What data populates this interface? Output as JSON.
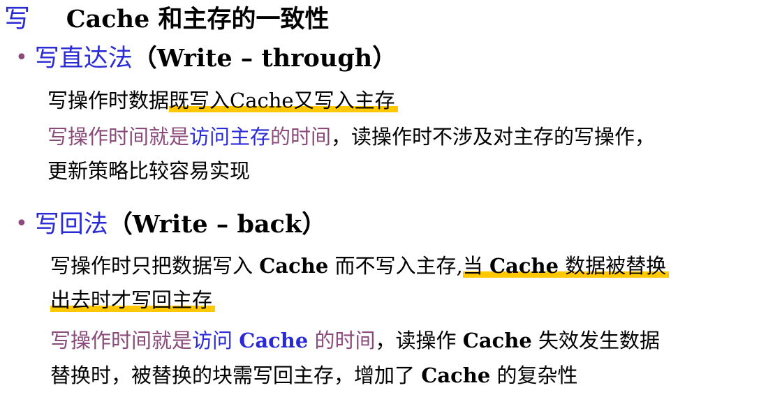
{
  "title": {
    "prefix": "写",
    "text": "Cache 和主存的一致性"
  },
  "write_through": {
    "bullet": "•",
    "heading_cn": "写直达法",
    "heading_en": "（Write – through）",
    "line1_a": "写操作时数据",
    "line1_highlight": "既写入Cache又写入主存",
    "line2_a": "写操作时间就是",
    "line2_b": "访问主存",
    "line2_c": "的时间",
    "line2_d": "，读操作时不涉及对主存的写操作，",
    "line3": "更新策略比较容易实现"
  },
  "write_back": {
    "bullet": "•",
    "heading_cn": "写回法",
    "heading_en": "（Write – back）",
    "line1_a": "写操作时只把数据写入 ",
    "line1_cache": "Cache",
    "line1_b": " 而不写入主存,",
    "line1_highlight_a": "当 ",
    "line1_highlight_cache": "Cache",
    "line1_highlight_b": " 数据被替换",
    "line2_highlight": "出去时才写回主存",
    "line3_a": "写操作时间就是",
    "line3_b": "访问 ",
    "line3_cache": "Cache",
    "line3_c": " 的时间",
    "line3_d": "，读操作 ",
    "line3_cache2": "Cache",
    "line3_e": " 失效发生数据",
    "line4_a": "替换时，被替换的块需写回主存，增加了 ",
    "line4_cache": "Cache",
    "line4_b": " 的复杂性"
  }
}
